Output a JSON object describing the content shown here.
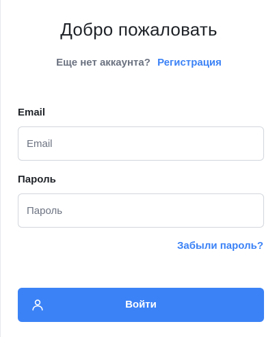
{
  "title": "Добро пожаловать",
  "signup": {
    "prompt": "Еще нет аккаунта?",
    "link_label": "Регистрация"
  },
  "form": {
    "email_label": "Email",
    "email_placeholder": "Email",
    "email_value": "",
    "password_label": "Пароль",
    "password_placeholder": "Пароль",
    "password_value": "",
    "forgot_label": "Забыли пароль?",
    "submit_label": "Войти",
    "submit_icon": "user-icon"
  },
  "colors": {
    "accent": "#3b82f6",
    "text": "#1f2328",
    "muted": "#6b7280",
    "border": "#d1d5db"
  }
}
